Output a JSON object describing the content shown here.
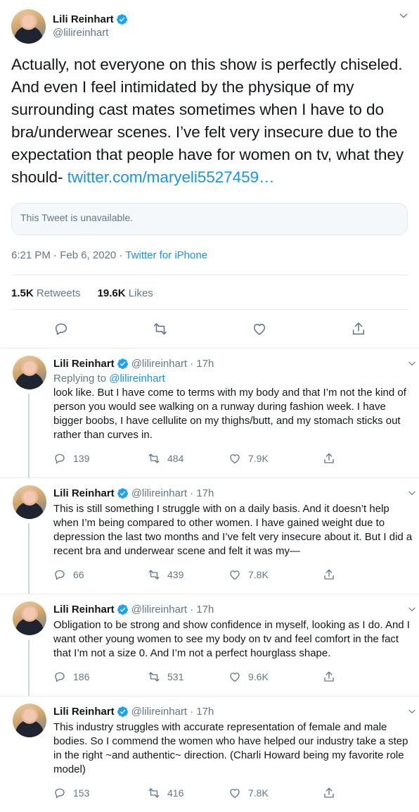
{
  "main_tweet": {
    "author_name": "Lili Reinhart",
    "handle": "@lilireinhart",
    "text": "Actually, not everyone on this show is perfectly chiseled. And even I feel intimidated by the physique of my surrounding cast mates sometimes when I have to do bra/underwear scenes. I’ve felt very insecure due to the expectation that people have for women on tv, what they should-",
    "link_text": "twitter.com/maryeli5527459…",
    "quoted_unavailable": "This Tweet is unavailable.",
    "time": "6:21 PM · Feb 6, 2020",
    "meta_separator": " · ",
    "source": "Twitter for iPhone",
    "retweets_count": "1.5K",
    "retweets_label": "Retweets",
    "likes_count": "19.6K",
    "likes_label": "Likes"
  },
  "replies": [
    {
      "author_name": "Lili Reinhart",
      "handle": "@lilireinhart",
      "age": "· 17h",
      "replying_prefix": "Replying to",
      "replying_to": "@lilireinhart",
      "text": "look like. But I have come to terms with my body and that I’m not the kind of person you would see walking on a runway during fashion week. I have bigger boobs, I have cellulite on my thighs/butt, and my stomach sticks out rather than curves in.",
      "replies": "139",
      "retweets": "484",
      "likes": "7.9K"
    },
    {
      "author_name": "Lili Reinhart",
      "handle": "@lilireinhart",
      "age": "· 17h",
      "text": "This is still something I struggle with on a daily basis. And it doesn’t help when I’m being compared to other women. I have gained weight due to depression the last two months and I’ve felt very insecure about it. But I did a recent bra and underwear scene and felt it was my—",
      "replies": "66",
      "retweets": "439",
      "likes": "7.8K"
    },
    {
      "author_name": "Lili Reinhart",
      "handle": "@lilireinhart",
      "age": "· 17h",
      "text": "Obligation to be strong and show confidence in myself, looking as I do. And I want other young women to see my body on tv and feel comfort in the fact that I’m not a size 0. And I’m not a perfect hourglass shape.",
      "replies": "186",
      "retweets": "531",
      "likes": "9.6K"
    },
    {
      "author_name": "Lili Reinhart",
      "handle": "@lilireinhart",
      "age": "· 17h",
      "text": "This industry struggles with accurate representation of female and male bodies. So I commend the women who have helped our industry take a step in the right ~and authentic~ direction. (Charli Howard being my favorite role model)",
      "replies": "153",
      "retweets": "416",
      "likes": "7.8K"
    }
  ],
  "icons": {
    "verified": "verified-badge-icon",
    "chevron": "chevron-down-icon",
    "reply": "reply-icon",
    "retweet": "retweet-icon",
    "like": "heart-icon",
    "share": "share-icon"
  },
  "colors": {
    "link": "#1b95e0",
    "verified": "#1da1f2",
    "secondary_text": "#657786",
    "divider": "#e6ecf0"
  }
}
